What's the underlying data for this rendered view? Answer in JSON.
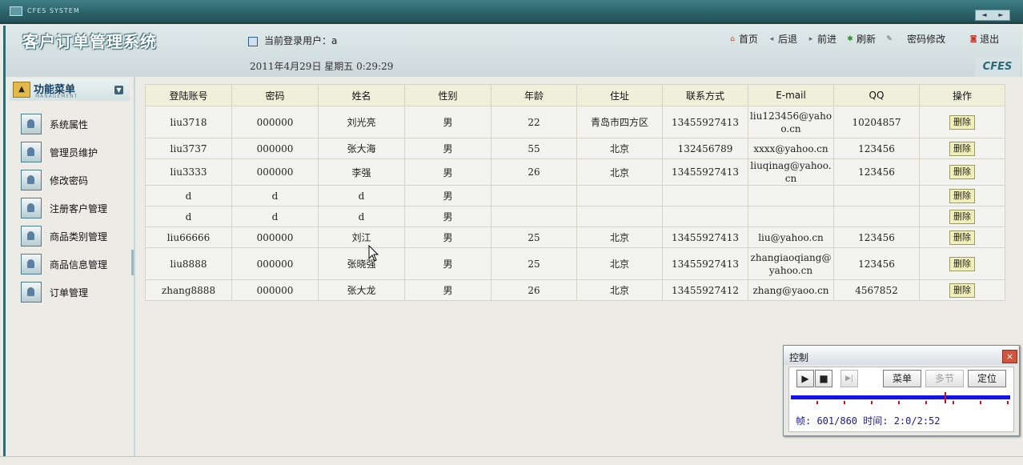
{
  "window": {
    "system_label": "CFES SYSTEM",
    "nav_prev": "◄",
    "nav_next": "►"
  },
  "header": {
    "app_title": "客户订单管理系统",
    "current_user_label": "当前登录用户：a",
    "datetime": "2011年4月29日  星期五  0:29:29",
    "brand": "CFES",
    "toolbar": {
      "home": "首页",
      "back": "后退",
      "forward": "前进",
      "refresh": "刷新",
      "change_password": "密码修改",
      "logout": "退出"
    }
  },
  "sidebar": {
    "title": "功能菜单",
    "subtitle": "MANAGEMENT",
    "items": [
      {
        "label": "系统属性"
      },
      {
        "label": "管理员维护"
      },
      {
        "label": "修改密码"
      },
      {
        "label": "注册客户管理"
      },
      {
        "label": "商品类别管理"
      },
      {
        "label": "商品信息管理"
      },
      {
        "label": "订单管理"
      }
    ]
  },
  "table": {
    "headers": [
      "登陆账号",
      "密码",
      "姓名",
      "性别",
      "年龄",
      "住址",
      "联系方式",
      "E-mail",
      "QQ",
      "操作"
    ],
    "delete_label": "删除",
    "rows": [
      [
        "liu3718",
        "000000",
        "刘光亮",
        "男",
        "22",
        "青岛市四方区",
        "13455927413",
        "liu123456@yahoo.cn",
        "10204857"
      ],
      [
        "liu3737",
        "000000",
        "张大海",
        "男",
        "55",
        "北京",
        "132456789",
        "xxxx@yahoo.cn",
        "123456"
      ],
      [
        "liu3333",
        "000000",
        "李强",
        "男",
        "26",
        "北京",
        "13455927413",
        "liuqinag@yahoo.cn",
        "123456"
      ],
      [
        "d",
        "d",
        "d",
        "男",
        "",
        "",
        "",
        "",
        ""
      ],
      [
        "d",
        "d",
        "d",
        "男",
        "",
        "",
        "",
        "",
        ""
      ],
      [
        "liu66666",
        "000000",
        "刘江",
        "男",
        "25",
        "北京",
        "13455927413",
        "liu@yahoo.cn",
        "123456"
      ],
      [
        "liu8888",
        "000000",
        "张晓强",
        "男",
        "25",
        "北京",
        "13455927413",
        "zhangiaoqiang@yahoo.cn",
        "123456"
      ],
      [
        "zhang8888",
        "000000",
        "张大龙",
        "男",
        "26",
        "北京",
        "13455927412",
        "zhang@yaoo.cn",
        "4567852"
      ]
    ]
  },
  "control": {
    "title": "控制",
    "close": "×",
    "play": "▶",
    "stop": "■",
    "step": "▶|",
    "menu": "菜单",
    "multi_section": "多节",
    "locate": "定位",
    "frame_info": "帧: 601/860 时间: 2:0/2:52",
    "progress": 0.7
  }
}
